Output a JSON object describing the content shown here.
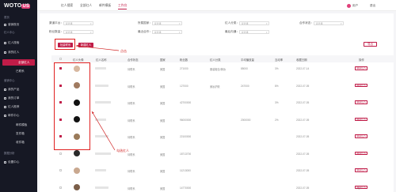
{
  "app": {
    "logo_text": "WOTO",
    "logo_mark": "US"
  },
  "sidebar": {
    "items": [
      {
        "label": "首页",
        "kind": "group"
      },
      {
        "label": "营销首页",
        "kind": "item"
      },
      {
        "label": "红人中心",
        "kind": "group"
      },
      {
        "label": "红人搜索",
        "kind": "item"
      },
      {
        "label": "我的红人",
        "kind": "item"
      },
      {
        "label": "全部红人",
        "kind": "sub-active"
      },
      {
        "label": "已联系",
        "kind": "sub"
      },
      {
        "label": "营销中心",
        "kind": "group"
      },
      {
        "label": "我的产品",
        "kind": "item"
      },
      {
        "label": "我的订单",
        "kind": "item"
      },
      {
        "label": "红人推荐",
        "kind": "item"
      },
      {
        "label": "邮件中心",
        "kind": "item"
      },
      {
        "label": "邮件模板",
        "kind": "sub"
      },
      {
        "label": "发件箱",
        "kind": "sub"
      },
      {
        "label": "收件箱",
        "kind": "sub"
      },
      {
        "label": "数据分析",
        "kind": "group"
      },
      {
        "label": "设置中心",
        "kind": "item"
      }
    ]
  },
  "topbar": {
    "tabs": [
      "红人搜索",
      "全部红人",
      "邮件模板",
      "工作台"
    ],
    "active_tab": 3,
    "user": "用户",
    "logout": "退出"
  },
  "filters": {
    "row1": [
      {
        "label": "渠道平台：",
        "placeholder": "请选择"
      },
      {
        "label": "所属国家：",
        "placeholder": "请选择"
      },
      {
        "label": "红人分类：",
        "placeholder": "请选择"
      },
      {
        "label": "合作状态：",
        "placeholder": "请选择"
      }
    ],
    "row2": [
      {
        "label": "粉丝数量：",
        "placeholder": "请选择"
      },
      {
        "label": "最近合作：",
        "placeholder": "请选择"
      },
      {
        "label": "最后沟通：",
        "placeholder": "请选择"
      }
    ]
  },
  "actions": {
    "batch_contact": "批量联系",
    "add_red": "新建红人",
    "export": "导出"
  },
  "table": {
    "headers": [
      "红人头像",
      "红人名称",
      "合作状态",
      "国家",
      "粉丝数",
      "红人分类",
      "平均播放量",
      "互动率",
      "收藏日期",
      "操作"
    ],
    "rows": [
      {
        "status": "待联系",
        "country": "美国",
        "fans": "271000",
        "category": "服装鞋包/美妆",
        "views": "85000",
        "rate": "3%",
        "date": "2022-07-14",
        "op": "联系红人",
        "checked": true
      },
      {
        "status": "待联系",
        "country": "美国",
        "fans": "127000",
        "category": "美妆护肤",
        "views": "247000",
        "rate": "8%",
        "date": "2022-07-05",
        "op": "联系红人",
        "checked": true
      },
      {
        "status": "待联系",
        "country": "美国",
        "fans": "42700000",
        "category": "",
        "views": "",
        "rate": "3%",
        "date": "2022-07-05",
        "op": "联系红人",
        "checked": true
      },
      {
        "status": "待联系",
        "country": "美国",
        "fans": "96000000",
        "category": "",
        "views": "2000000",
        "rate": "2%",
        "date": "2022-07-05",
        "op": "联系红人",
        "checked": true
      },
      {
        "status": "待联系",
        "country": "美国",
        "fans": "22100000",
        "category": "",
        "views": "",
        "rate": "",
        "date": "2022-07-05",
        "op": "联系红人",
        "checked": true
      },
      {
        "status": "待联系",
        "country": "美国",
        "fans": "18713700",
        "category": "",
        "views": "",
        "rate": "",
        "date": "2022-07-05",
        "op": "联系红人",
        "checked": false
      },
      {
        "status": "待联系",
        "country": "美国",
        "fans": "11213000",
        "category": "",
        "views": "",
        "rate": "",
        "date": "2022-07-05",
        "op": "联系红人",
        "checked": false
      },
      {
        "status": "待联系",
        "country": "美国",
        "fans": "14770000",
        "category": "",
        "views": "",
        "rate": "",
        "date": "2022-07-05",
        "op": "联系红人",
        "checked": false
      }
    ]
  },
  "annotations": {
    "click": "点击",
    "select": "勾选红人"
  },
  "colors": {
    "accent": "#c01c48",
    "sidebar_bg": "#161824",
    "annotation": "#d02020"
  }
}
